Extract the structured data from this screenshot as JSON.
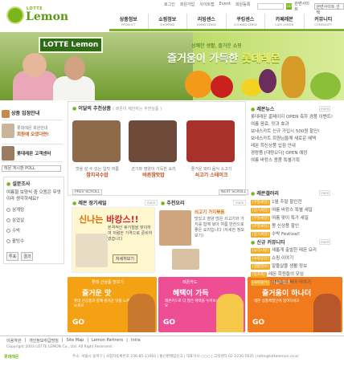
{
  "logo": {
    "brand_top": "LOTTE",
    "brand_main": "Lemon"
  },
  "util_links": [
    "로그인",
    "회원가입",
    "사이트맵",
    "Event",
    "회원등록"
  ],
  "top_search": {
    "placeholder": "",
    "go": "GO",
    "label": "관련사이트",
    "select_value": "관련사이트 선택"
  },
  "gnb": [
    {
      "ko": "상품정보",
      "en": "PRODUCT"
    },
    {
      "ko": "쇼핑정보",
      "en": "SHOPPING"
    },
    {
      "ko": "리빙센스",
      "en": "LIVING SENSE"
    },
    {
      "ko": "쿠킹센스",
      "en": "COOKING SENSE"
    },
    {
      "ko": "카페레몬",
      "en": "CAFE LEMON"
    },
    {
      "ko": "커뮤니티",
      "en": "COMMUNITY"
    }
  ],
  "banner": {
    "sign": "LOTTE Lemon",
    "cap_small": "상쾌한 생활, 즐거운 쇼핑",
    "cap_big_1": "즐거움이 가득한 ",
    "cap_big_2": "롯데레몬"
  },
  "left": {
    "shopping_guide": "상품 입점안내",
    "notice_text": "롯데레몬 회원안내",
    "notice_btn": "회원에 오셨다면!",
    "center_title": "롯데레몬 고객센터",
    "poll_select": "레몬 게시판 POLL",
    "poll_head": "설문조사",
    "poll_q": "여름철 보양식 중 으뜸은 무엇이라 생각하세요?",
    "poll_options": [
      "삼계탕",
      "삼겹살",
      "수박",
      "팥빙수"
    ],
    "poll_vote": "투표",
    "poll_result": "결과"
  },
  "reco": {
    "title": "이달의 추천상품",
    "sub": "( 레몬이 제안하는 추천상품 )",
    "products": [
      {
        "desc": "맛을 살 수 있는 입맛 여름",
        "name": "참치국수밥"
      },
      {
        "desc": "끈기와 영양이 가득한 요리",
        "name": "바른참맛밥"
      },
      {
        "desc": "즐거운 파티 음식 소고기",
        "name": "쇠고기 스테이크"
      }
    ],
    "prev": "PREV SCROLL",
    "next": "NEXT SCROLL"
  },
  "event": {
    "title": "레몬 장기세일",
    "more": "more",
    "headline_1": "신나는 ",
    "headline_2": "바캉스!!",
    "text": "본격적인 휴가철을 맞이하여 저렴한 가격으로 준비하였습니다",
    "btn": "자세히보기"
  },
  "recipe": {
    "title": "추천요리",
    "more": "more",
    "name": "쇠고기 가지볶음",
    "text": "맛있고 영양 많은 쇠고기와 가지를 함께 볶아 여름 반찬으로 좋은 요리입니다 (자세한 정보 보기)"
  },
  "promos": [
    {
      "tag": "롯데 신상품 맛보기",
      "headline": "즐거운 맛",
      "sub": "롯데 신상품과 함께 즐거운 맛을 느껴보세요",
      "go": "GO",
      "color": "#f4a214"
    },
    {
      "tag": "레몬카드",
      "headline": "혜택이 가득",
      "sub": "레몬카드로 더 많은 혜택을 누려보세요",
      "go": "GO",
      "color": "#ee4e93"
    },
    {
      "tag": "상품체험단",
      "headline": "즐거움이 하나더",
      "sub": "레몬 상품체험단에 참여하세요",
      "go": "GO",
      "color": "#f07a1c"
    }
  ],
  "news": {
    "title": "레몬뉴스",
    "more": "more",
    "items": [
      "롯데레몬 홈페이지 OPEN 축하 경품 이벤트!",
      "여름 음료, 맛과 효과",
      "보네스카트 신규 가입시 500원 할인!",
      "보네스카트 회원님들께 새로운 혜택",
      "레몬 최신상품 입점 안내",
      "경량품 [대량오더] OPEN 예정",
      "여름 바캉스 용품 특별기획"
    ]
  },
  "lemon_cards": {
    "title": "레몬갤러리",
    "more": "more",
    "items": [
      {
        "badge": "[주말세일]",
        "text": "1월 주말 할인전"
      },
      {
        "badge": "[장기세일]",
        "text": "여름 바캉스 특별 세일"
      },
      {
        "badge": "[주말세일]",
        "text": "여름 맞이 특가 세일"
      },
      {
        "badge": "[주말세일]",
        "text": "봄 신상품 할인"
      },
      {
        "badge": "[장기세일]",
        "text": "수박 Festival!"
      }
    ]
  },
  "community": {
    "title": "신규 커뮤니티",
    "more": "more",
    "items": [
      {
        "badge": "[요리사랑]",
        "text": "새롭게 출발한 레몬 요리"
      },
      {
        "badge": "[쇼핑공감]",
        "text": "쇼핑 이야기"
      },
      {
        "badge": "[생활정보]",
        "text": "알뜰살뜰 생활 정보"
      },
      {
        "badge": "[동호회]",
        "text": "레몬 회원들의 모임"
      },
      {
        "badge": "[육아일기]",
        "text": "엄마들의 육아 이야기"
      }
    ]
  },
  "footer": {
    "links": [
      "이용약관",
      "개인정보취급방침",
      "Site Map",
      "Lemon Partners",
      "Intra"
    ],
    "copyright": "Copyright 2003 LOTTE LEMON Co., Ltd. All Right Reserved.",
    "logo": "롯데레몬",
    "addr": "주소: 서울시 송파구 | 사업자등록번호 236-85-11693 | 통신판매업신고 | 대표이사 ○○○ | 고객센터 02-2230-5635 | lotte@lottelemon.co.kr"
  }
}
